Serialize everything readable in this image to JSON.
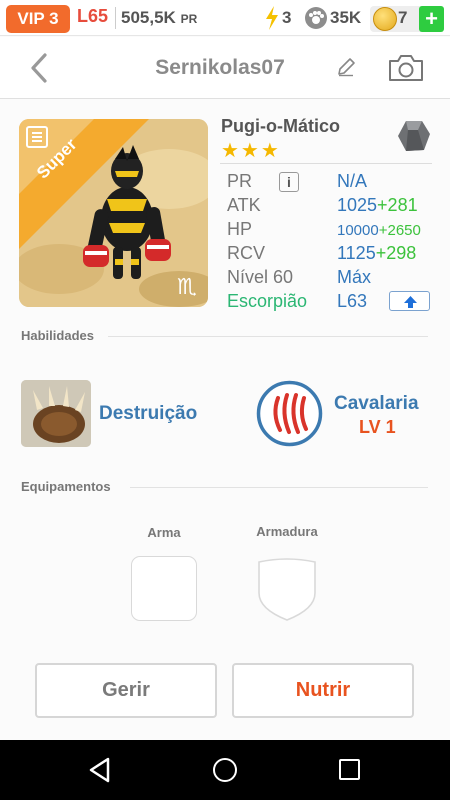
{
  "topbar": {
    "vip": "VIP 3",
    "level": "L65",
    "power": "505,5K",
    "power_unit": "PR",
    "energy": "3",
    "paws": "35K",
    "coins": "7",
    "add": "+"
  },
  "header": {
    "title": "Sernikolas07"
  },
  "pet": {
    "badge": "Super",
    "name": "Pugi-o-Mático",
    "stars": "★★★",
    "zodiac_symbol": "♏",
    "stats": {
      "pr_label": "PR",
      "pr_value": "N/A",
      "atk_label": "ATK",
      "atk_value": "1025",
      "atk_bonus": "+281",
      "hp_label": "HP",
      "hp_value": "10000",
      "hp_bonus": "+2650",
      "rcv_label": "RCV",
      "rcv_value": "1125",
      "rcv_bonus": "+298",
      "level_label": "Nível 60",
      "level_value": "Máx",
      "sign_label": "Escorpião",
      "sign_value": "L63"
    }
  },
  "abilities": {
    "section": "Habilidades",
    "skill1": "Destruição",
    "skill2": "Cavalaria",
    "skill2_level": "LV 1"
  },
  "equipment": {
    "section": "Equipamentos",
    "weapon": "Arma",
    "armor": "Armadura"
  },
  "actions": {
    "manage": "Gerir",
    "feed": "Nutrir"
  },
  "colors": {
    "vip": "#f26b2c",
    "level": "#e74c3c",
    "link_blue": "#3377bb",
    "bonus_green": "#3cc23c",
    "accent_orange": "#e8531f"
  }
}
